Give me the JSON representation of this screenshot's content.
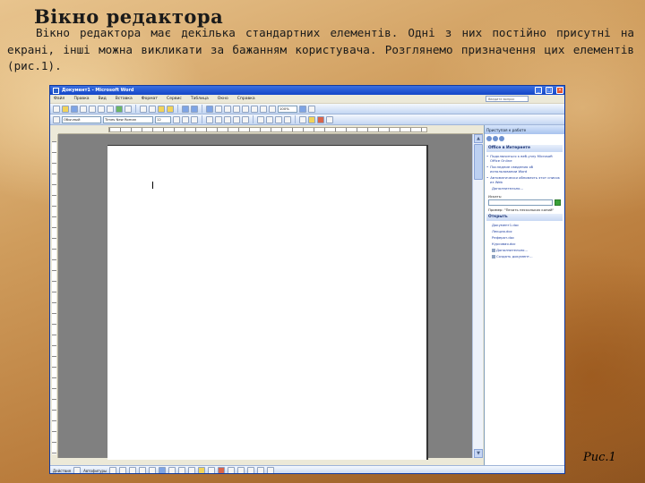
{
  "slide": {
    "title": "Вікно редактора",
    "intro": "Вікно редактора має декілька стандартних елементів. Одні з них постійно присутні на екрані, інші можна викликати за бажанням користувача. Розглянемо призначення цих елементів (рис.1).",
    "caption": "Рис.1"
  },
  "window": {
    "title": "Документ1 - Microsoft Word",
    "menu": [
      "Файл",
      "Правка",
      "Вид",
      "Вставка",
      "Формат",
      "Сервис",
      "Таблица",
      "Окно",
      "Справка"
    ],
    "help_placeholder": "Введите вопрос",
    "style_value": "Обычный",
    "font_value": "Times New Roman",
    "size_value": "12",
    "zoom_value": "100%"
  },
  "taskpane": {
    "title": "Приступая к работе",
    "section_office": "Office в Интернете",
    "links": [
      "Подключиться к веб-узлу Microsoft Office Online",
      "Последние сведения об использовании Word",
      "Автоматически обновлять этот список из Web"
    ],
    "more": "Дополнительно...",
    "search_label": "Искать:",
    "example": "Пример: \"Печать нескольких копий\"",
    "section_open": "Открыть",
    "files": [
      "Документ1.doc",
      "Лекция.doc",
      "Реферат.doc",
      "Курсовая.doc"
    ],
    "more_files": "Дополнительно...",
    "create": "Создать документ..."
  },
  "drawbar": {
    "actions_label": "Действия",
    "autoshapes_label": "Автофигуры"
  },
  "colors": {
    "title_bar": "#1346c8",
    "toolbar": "#c4d6f2",
    "doc_background": "#808080"
  }
}
